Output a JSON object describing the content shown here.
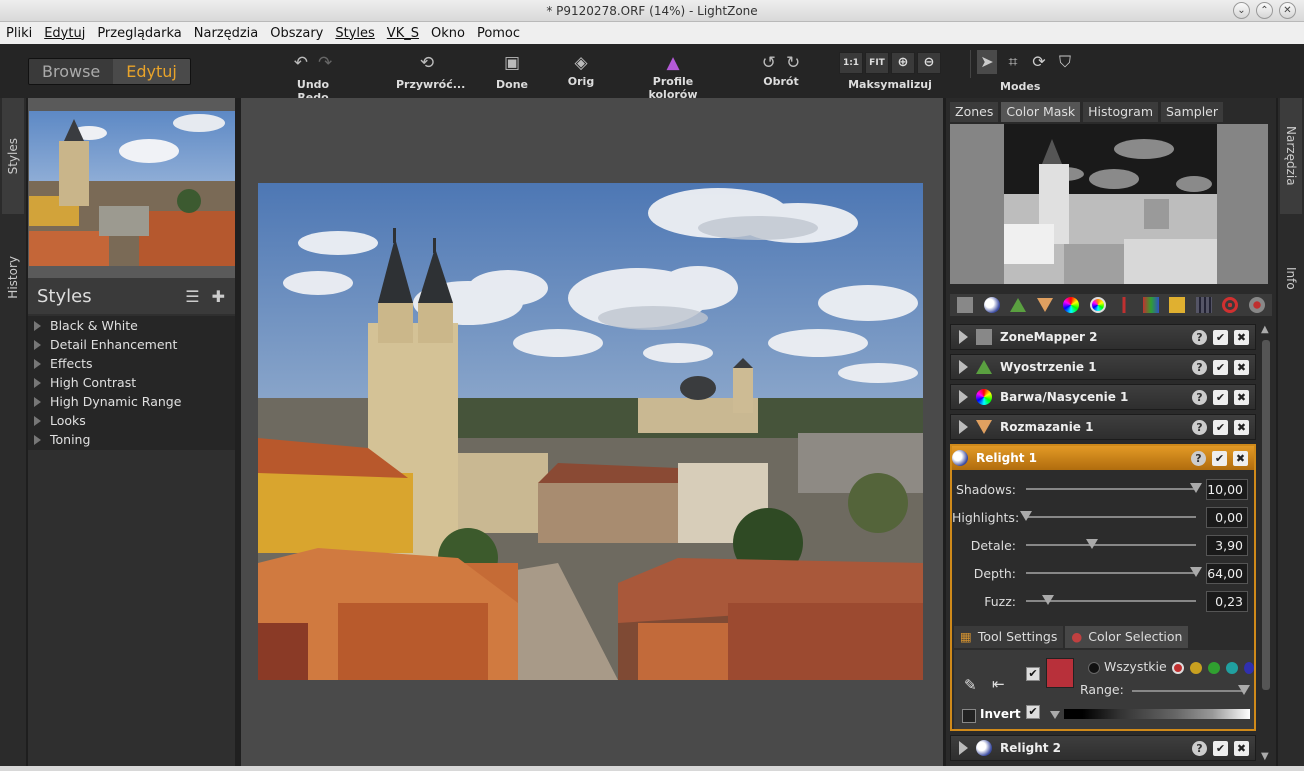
{
  "window": {
    "title": "* P9120278.ORF (14%) - LightZone"
  },
  "menu": [
    "Pliki",
    "Edytuj",
    "Przeglądarka",
    "Narzędzia",
    "Obszary",
    "Styles",
    "VK_S",
    "Okno",
    "Pomoc"
  ],
  "mode_switch": {
    "browse": "Browse",
    "edit": "Edytuj"
  },
  "toolbar": {
    "undo_redo": "Undo Redo",
    "revert": "Przywróć...",
    "done": "Done",
    "orig": "Orig",
    "profiles": "Profile kolorów",
    "rotate": "Obrót",
    "zoom_1to1": "1:1",
    "zoom_fit": "FIT",
    "maximize": "Maksymalizuj",
    "modes": "Modes"
  },
  "left_tabs": {
    "styles": "Styles",
    "history": "History"
  },
  "styles_panel": {
    "title": "Styles",
    "items": [
      "Black & White",
      "Detail Enhancement",
      "Effects",
      "High Contrast",
      "High Dynamic Range",
      "Looks",
      "Toning"
    ]
  },
  "right_tabs": {
    "tools": "Narzędzia",
    "info": "Info"
  },
  "inspector_tabs": [
    "Zones",
    "Color Mask",
    "Histogram",
    "Sampler"
  ],
  "tools": [
    {
      "name": "ZoneMapper 2"
    },
    {
      "name": "Wyostrzenie 1"
    },
    {
      "name": "Barwa/Nasycenie 1"
    },
    {
      "name": "Rozmazanie 1"
    }
  ],
  "relight": {
    "name": "Relight 1",
    "sliders": [
      {
        "label": "Shadows:",
        "value": "10,00",
        "pos": 1.0
      },
      {
        "label": "Highlights:",
        "value": "0,00",
        "pos": 0.0
      },
      {
        "label": "Detale:",
        "value": "3,90",
        "pos": 0.39
      },
      {
        "label": "Depth:",
        "value": "64,00",
        "pos": 1.0
      },
      {
        "label": "Fuzz:",
        "value": "0,23",
        "pos": 0.13
      }
    ],
    "subtabs": {
      "tool_settings": "Tool Settings",
      "color_selection": "Color Selection"
    },
    "color_selection": {
      "all_label": "Wszystkie",
      "range_label": "Range:",
      "invert_label": "Invert",
      "swatch_color": "#b8303a"
    }
  },
  "tool_last": {
    "name": "Relight 2"
  },
  "colors": {
    "accent": "#e8a32a",
    "active_tool": "#d08a1a"
  }
}
